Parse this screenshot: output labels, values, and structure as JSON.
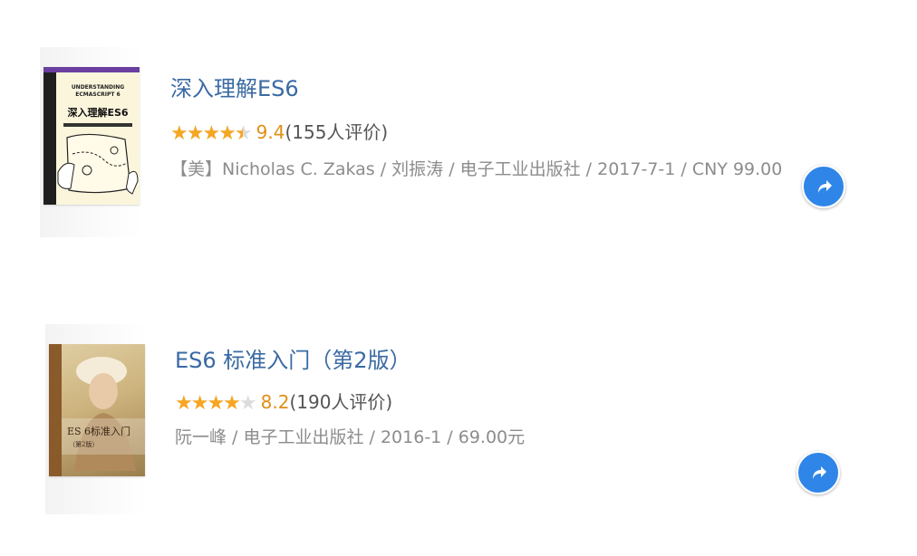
{
  "books": [
    {
      "title": "深入理解ES6",
      "stars": "★★★★",
      "stars_half": "★",
      "stars_empty": "",
      "score": "9.4",
      "votes": "(155人评价)",
      "meta": "【美】Nicholas C. Zakas / 刘振涛 / 电子工业出版社 / 2017-7-1 / CNY 99.00",
      "cover": {
        "header": "UNDERSTANDING",
        "subheader": "ECMASCRIPT 6",
        "title": "深入理解ES6"
      }
    },
    {
      "title": "ES6 标准入门（第2版）",
      "stars": "★★★★",
      "stars_half": "",
      "stars_empty": "★",
      "score": "8.2",
      "votes": "(190人评价)",
      "meta": "阮一峰 / 电子工业出版社 / 2016-1 / 69.00元",
      "cover": {
        "title": "ES 6标准入门",
        "subtitle": "（第2版）"
      }
    }
  ],
  "icons": {
    "share": "share-arrow-icon"
  },
  "colors": {
    "title": "#3a6aa3",
    "star": "#f5a623",
    "score": "#e09015",
    "meta": "#8c8c8c",
    "share_button": "#2f86e8"
  }
}
